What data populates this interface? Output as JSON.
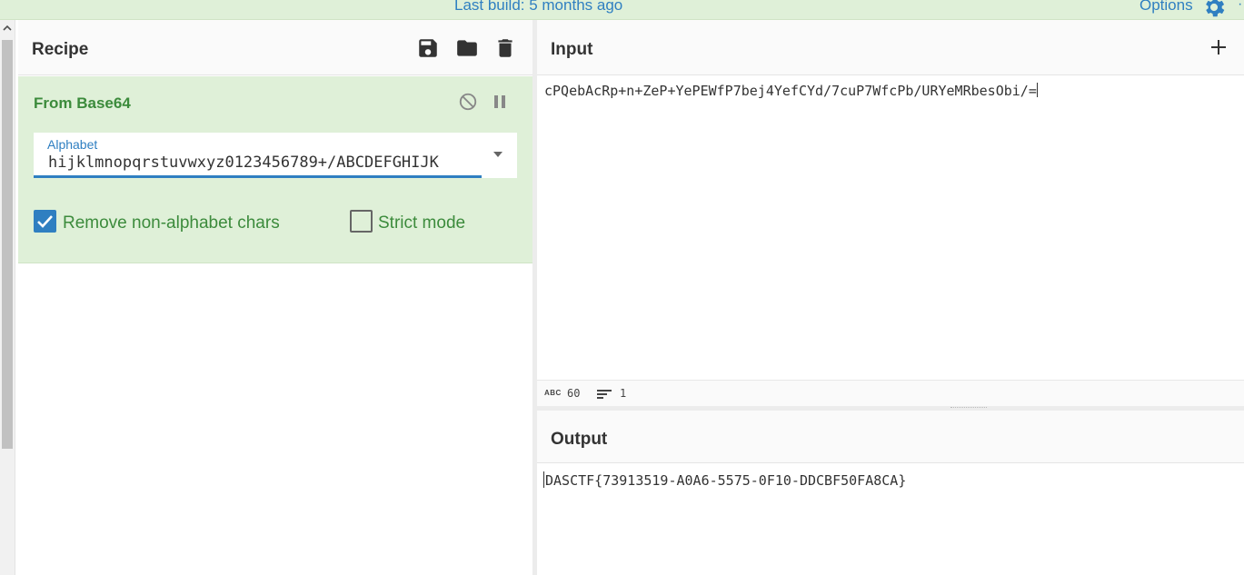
{
  "banner": {
    "build_text": "Last build: 5 months ago",
    "options_label": "Options",
    "overflow_label": "·"
  },
  "recipe": {
    "title": "Recipe",
    "icons": [
      "save-icon",
      "folder-icon",
      "trash-icon"
    ],
    "operation": {
      "name": "From Base64",
      "alphabet_label": "Alphabet",
      "alphabet_value": "hijklmnopqrstuvwxyz0123456789+/ABCDEFGHIJK",
      "remove_non_alphabet": {
        "label": "Remove non-alphabet chars",
        "checked": true
      },
      "strict_mode": {
        "label": "Strict mode",
        "checked": false
      }
    }
  },
  "input": {
    "title": "Input",
    "text": "cPQebAcRp+n+ZeP+YePEWfP7bej4YefCYd/7cuP7WfcPb/URYeMRbesObi/=",
    "status": {
      "abc_label": "ABC",
      "length": "60",
      "lines": "1"
    }
  },
  "output": {
    "title": "Output",
    "text": "DASCTF{73913519-A0A6-5575-0F10-DDCBF50FA8CA}"
  },
  "colors": {
    "accent": "#2f7fc1",
    "op_bg": "#dff0d8",
    "op_text": "#3c8b3c"
  }
}
